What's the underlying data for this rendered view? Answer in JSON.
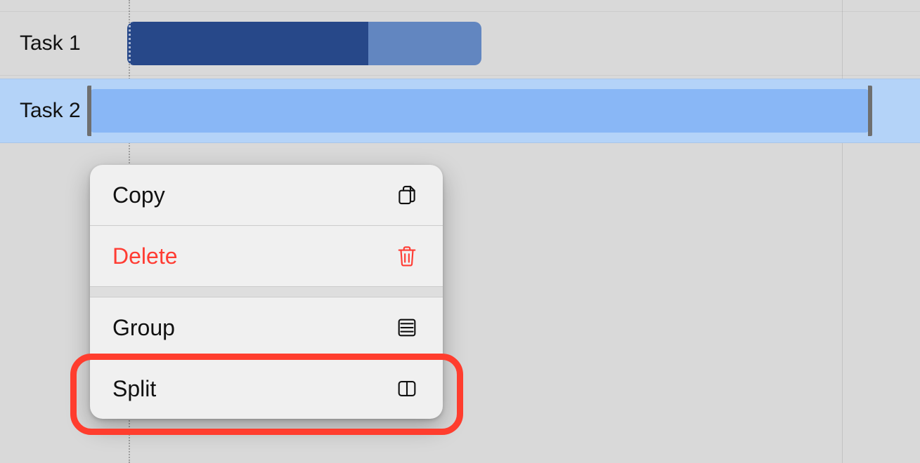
{
  "tasks": [
    {
      "label": "Task 1"
    },
    {
      "label": "Task 2"
    }
  ],
  "menu": {
    "copy": "Copy",
    "delete": "Delete",
    "group": "Group",
    "split": "Split"
  },
  "colors": {
    "bar1_fill": "#6286c0",
    "bar1_progress": "#274889",
    "bar2_fill": "#89b7f6",
    "selected_row": "#b4d3f8",
    "danger": "#ff3c33",
    "highlight": "#ff3d2e"
  }
}
